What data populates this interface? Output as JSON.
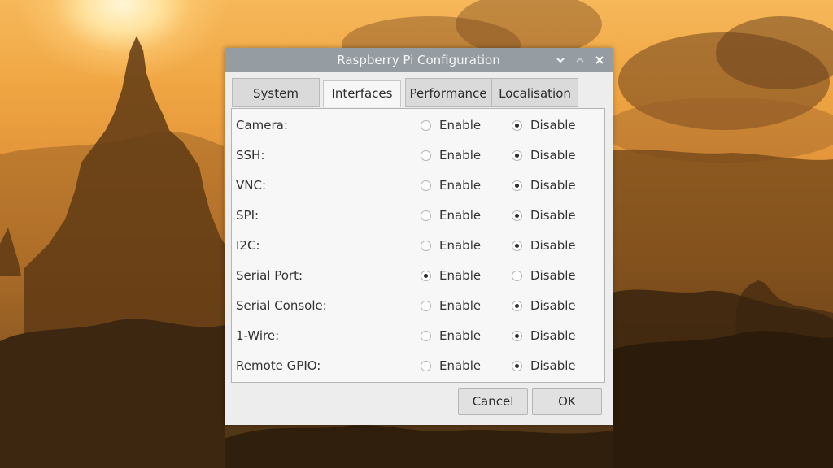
{
  "window": {
    "title": "Raspberry Pi Configuration"
  },
  "tabs": [
    {
      "label": "System"
    },
    {
      "label": "Interfaces",
      "active": true
    },
    {
      "label": "Performance"
    },
    {
      "label": "Localisation"
    }
  ],
  "options": {
    "enable_label": "Enable",
    "disable_label": "Disable"
  },
  "interfaces": [
    {
      "name": "Camera:",
      "enabled": false
    },
    {
      "name": "SSH:",
      "enabled": false
    },
    {
      "name": "VNC:",
      "enabled": false
    },
    {
      "name": "SPI:",
      "enabled": false
    },
    {
      "name": "I2C:",
      "enabled": false
    },
    {
      "name": "Serial Port:",
      "enabled": true
    },
    {
      "name": "Serial Console:",
      "enabled": false
    },
    {
      "name": "1-Wire:",
      "enabled": false
    },
    {
      "name": "Remote GPIO:",
      "enabled": false
    }
  ],
  "buttons": {
    "cancel": "Cancel",
    "ok": "OK"
  },
  "icons": {
    "minimize": "chevron-down-icon",
    "maximize": "chevron-up-icon",
    "close": "close-icon"
  },
  "colors": {
    "titlebar": "#959da2",
    "dialog_bg": "#ededed",
    "panel_bg": "#f7f7f7"
  }
}
